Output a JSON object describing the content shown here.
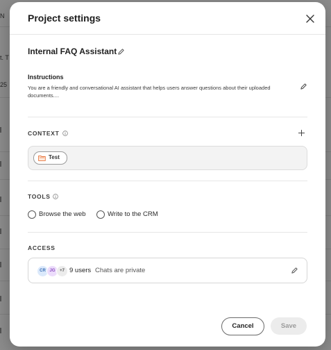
{
  "background": {
    "fragments": [
      "N",
      "t. T",
      "25"
    ]
  },
  "modal": {
    "title": "Project settings",
    "project_name": "Internal FAQ Assistant",
    "instructions": {
      "label": "Instructions",
      "text": "You are a friendly and conversational AI assistant that helps users answer questions about their uploaded documents...."
    },
    "context": {
      "label": "CONTEXT",
      "items": [
        {
          "label": "Test",
          "icon": "folder-icon"
        }
      ]
    },
    "tools": {
      "label": "TOOLS",
      "options": [
        {
          "label": "Browse the web",
          "checked": false
        },
        {
          "label": "Write to the CRM",
          "checked": false
        }
      ]
    },
    "access": {
      "label": "ACCESS",
      "avatars": [
        "CR",
        "JG",
        "+7"
      ],
      "users_count": "9 users",
      "privacy": "Chats are private"
    },
    "footer": {
      "cancel_label": "Cancel",
      "save_label": "Save",
      "save_enabled": false
    }
  },
  "colors": {
    "accent_orange": "#e8743b",
    "avatar_cr_bg": "#dbe9fb",
    "avatar_jg_bg": "#ecdcfb",
    "avatar_more_bg": "#ececec"
  }
}
